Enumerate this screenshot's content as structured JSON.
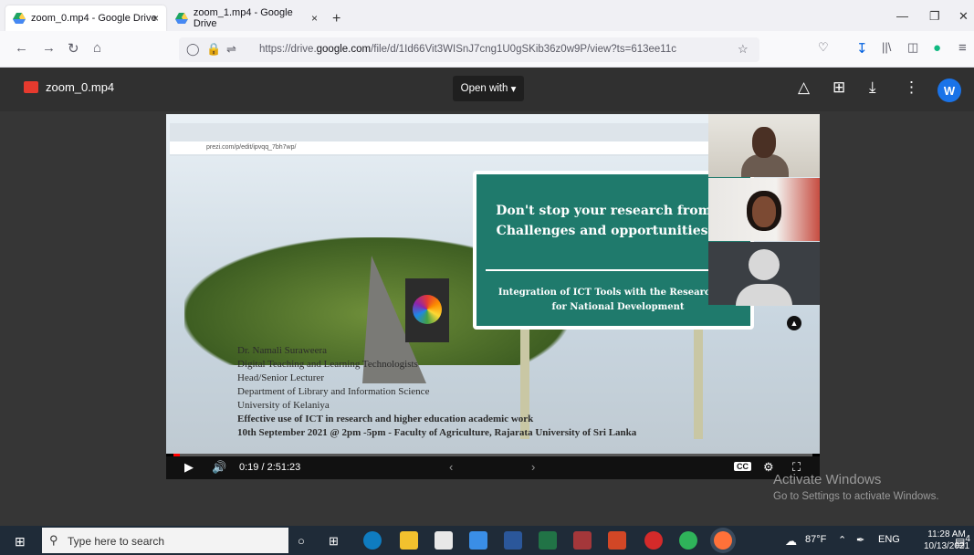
{
  "browser": {
    "tabs": [
      {
        "label": "zoom_0.mp4 - Google Drive",
        "active": true
      },
      {
        "label": "zoom_1.mp4 - Google Drive",
        "active": false
      }
    ],
    "tab_close_glyph": "×",
    "new_tab_glyph": "+",
    "url_prefix": "https://drive.",
    "url_domain": "google.com",
    "url_path": "/file/d/1Id66Vit3WISnJ7cng1U0gSKib36z0w9P/view?ts=613ee11c"
  },
  "viewer": {
    "file_name": "zoom_0.mp4",
    "open_with_label": "Open with",
    "avatar_initial": "W"
  },
  "slide": {
    "screenshot_url": "prezi.com/p/edit/ipvqq_7bh7wp/",
    "sign_line1": "Don't stop your research from her",
    "sign_line2": "Challenges and opportunities Ahe",
    "sign_line3": "Integration of ICT Tools with the Research Pro",
    "sign_line4": "for National Development",
    "credits": [
      "Dr. Namali Suraweera",
      "Digital Teaching and Learning Technologists",
      "Head/Senior Lecturer",
      "Department of Library and Information Science",
      "University of Kelaniya"
    ],
    "credit_bold1": "Effective use of ICT in  research and higher education academic work",
    "credit_bold2": "10th September 2021 @ 2pm -5pm -  Faculty of Agriculture, Rajarata University of Sri Lanka"
  },
  "player": {
    "time_display": "0:19 / 2:51:23",
    "progress_fraction": 0.002,
    "cc_label": "CC"
  },
  "watermark": {
    "line1": "Activate Windows",
    "line2": "Go to Settings to activate Windows."
  },
  "taskbar": {
    "search_placeholder": "Type here to search",
    "weather": "87°F",
    "lang": "ENG",
    "time": "11:28 AM",
    "date": "10/13/2021",
    "notif_count": "4"
  },
  "colors": {
    "sign_green": "#1f7a6c",
    "progress_red": "#ff0000",
    "avatar_blue": "#1a73e8"
  }
}
